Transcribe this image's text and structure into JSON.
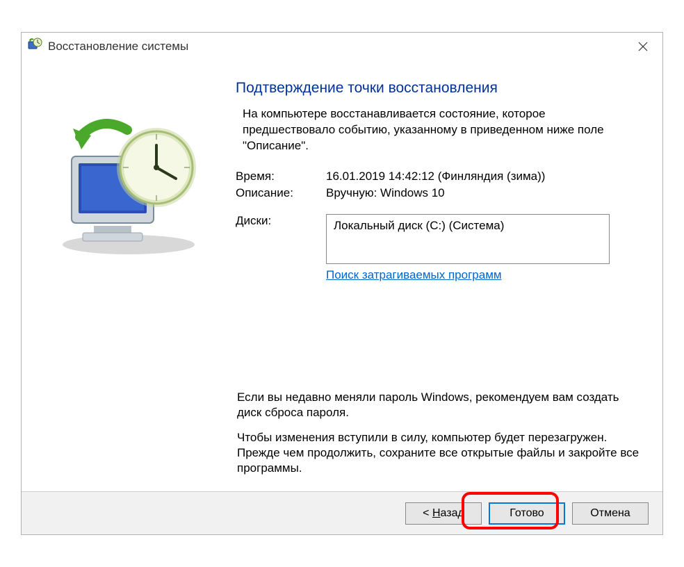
{
  "window": {
    "title": "Восстановление системы"
  },
  "main": {
    "heading": "Подтверждение точки восстановления",
    "intro": "На компьютере восстанавливается состояние, которое предшествовало событию, указанному в приведенном ниже поле \"Описание\".",
    "time_label": "Время:",
    "time_value": "16.01.2019 14:42:12 (Финляндия (зима))",
    "desc_label": "Описание:",
    "desc_value": "Вручную: Windows 10",
    "disks_label": "Диски:",
    "disks_value": "Локальный диск (C:) (Система)",
    "affected_link": "Поиск затрагиваемых программ",
    "note1": "Если вы недавно меняли пароль Windows, рекомендуем вам создать диск сброса пароля.",
    "note2": "Чтобы изменения вступили в силу, компьютер будет перезагружен. Прежде чем продолжить, сохраните все открытые файлы и закройте все программы."
  },
  "footer": {
    "back_prefix": "< ",
    "back_underlined": "Н",
    "back_rest": "азад",
    "finish": "Готово",
    "cancel": "Отмена"
  }
}
